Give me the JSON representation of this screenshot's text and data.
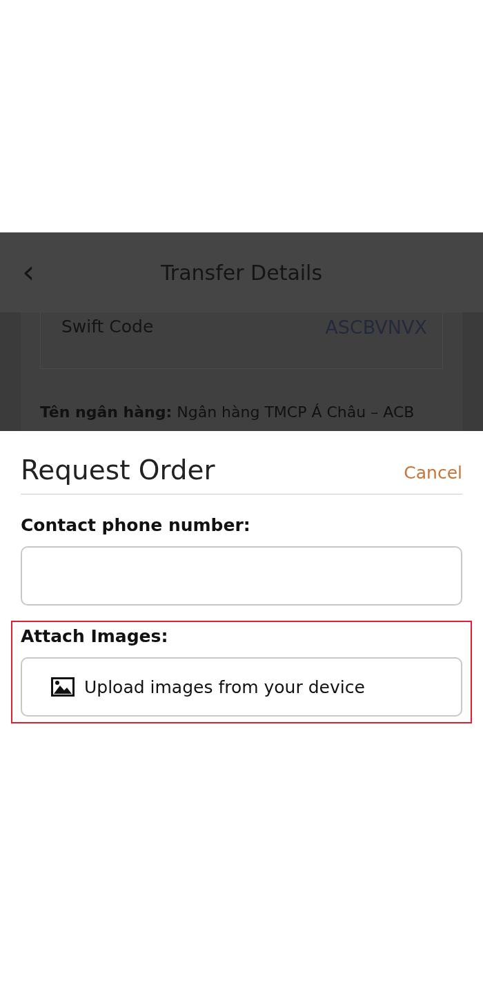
{
  "background_screen": {
    "header": {
      "back": "‹",
      "title": "Transfer Details"
    },
    "card": {
      "label": "Swift Code",
      "value": "ASCBVNVX"
    },
    "bank_line": "**Tên ngân hàng:** Ngân hàng TMCP Á Châu – ACB"
  },
  "sheet": {
    "title": "Request Order",
    "cancel": "Cancel",
    "phone": {
      "label": "Contact phone number:"
    },
    "attach": {
      "label": "Attach Images:",
      "button": "Upload images from your device",
      "highlighted": true
    }
  }
}
